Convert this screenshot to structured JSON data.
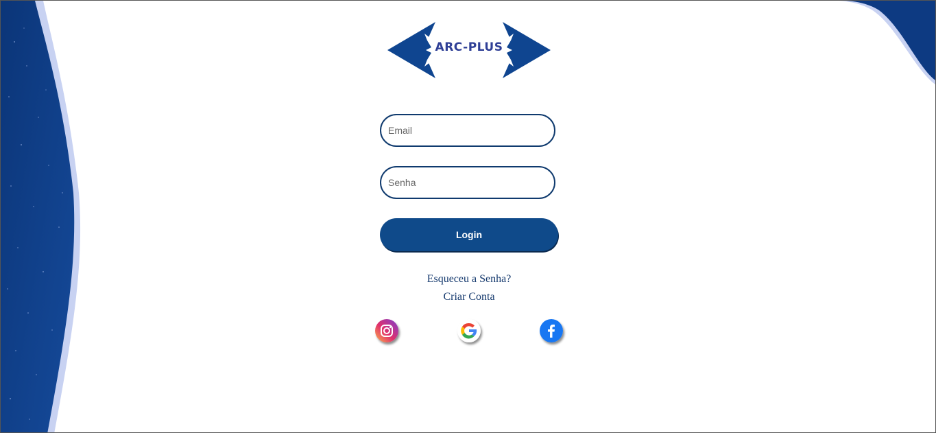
{
  "logo": {
    "text": "ARC-PLUS"
  },
  "form": {
    "email_placeholder": "Email",
    "senha_placeholder": "Senha",
    "login_label": "Login"
  },
  "links": {
    "forgot": "Esqueceu a Senha?",
    "create": "Criar Conta"
  },
  "social": [
    {
      "icon": "instagram-icon"
    },
    {
      "icon": "google-icon"
    },
    {
      "icon": "facebook-icon"
    }
  ],
  "colors": {
    "brand_blue": "#0f4a8a",
    "link_blue": "#163a6e",
    "logo_text": "#2f3f96",
    "decor_blue": "#0d3a82",
    "decor_light": "#c8d2f2"
  }
}
